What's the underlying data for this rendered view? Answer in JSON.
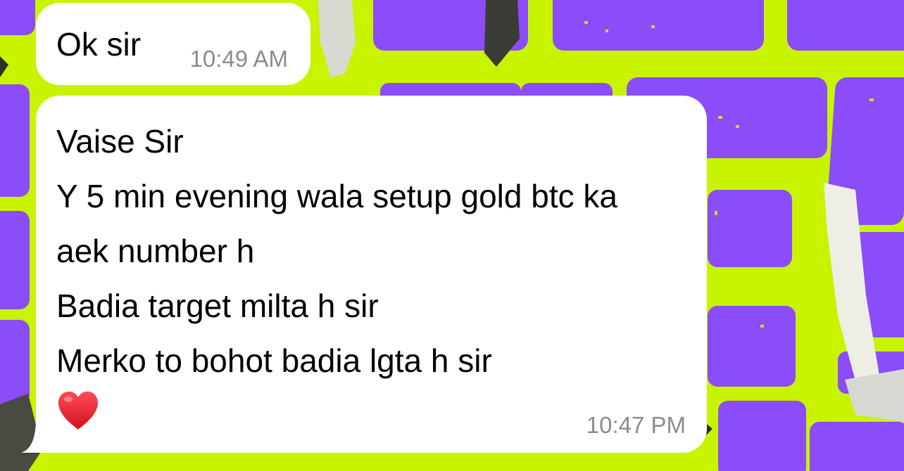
{
  "messages": [
    {
      "text": "Ok sir",
      "time": "10:49 AM"
    },
    {
      "lines": [
        "Vaise Sir",
        "Y 5 min evening wala setup gold btc ka",
        "aek number h",
        "Badia target milta h sir",
        "Merko to bohot badia lgta h sir"
      ],
      "emoji": "heart-emoji",
      "time": "10:47 PM"
    }
  ],
  "colors": {
    "wallpaper_green": "#c8f400",
    "wallpaper_purple": "#8b4cfa",
    "bubble": "#ffffff",
    "timestamp": "#8c8c8c",
    "heart": "#e0182c"
  }
}
